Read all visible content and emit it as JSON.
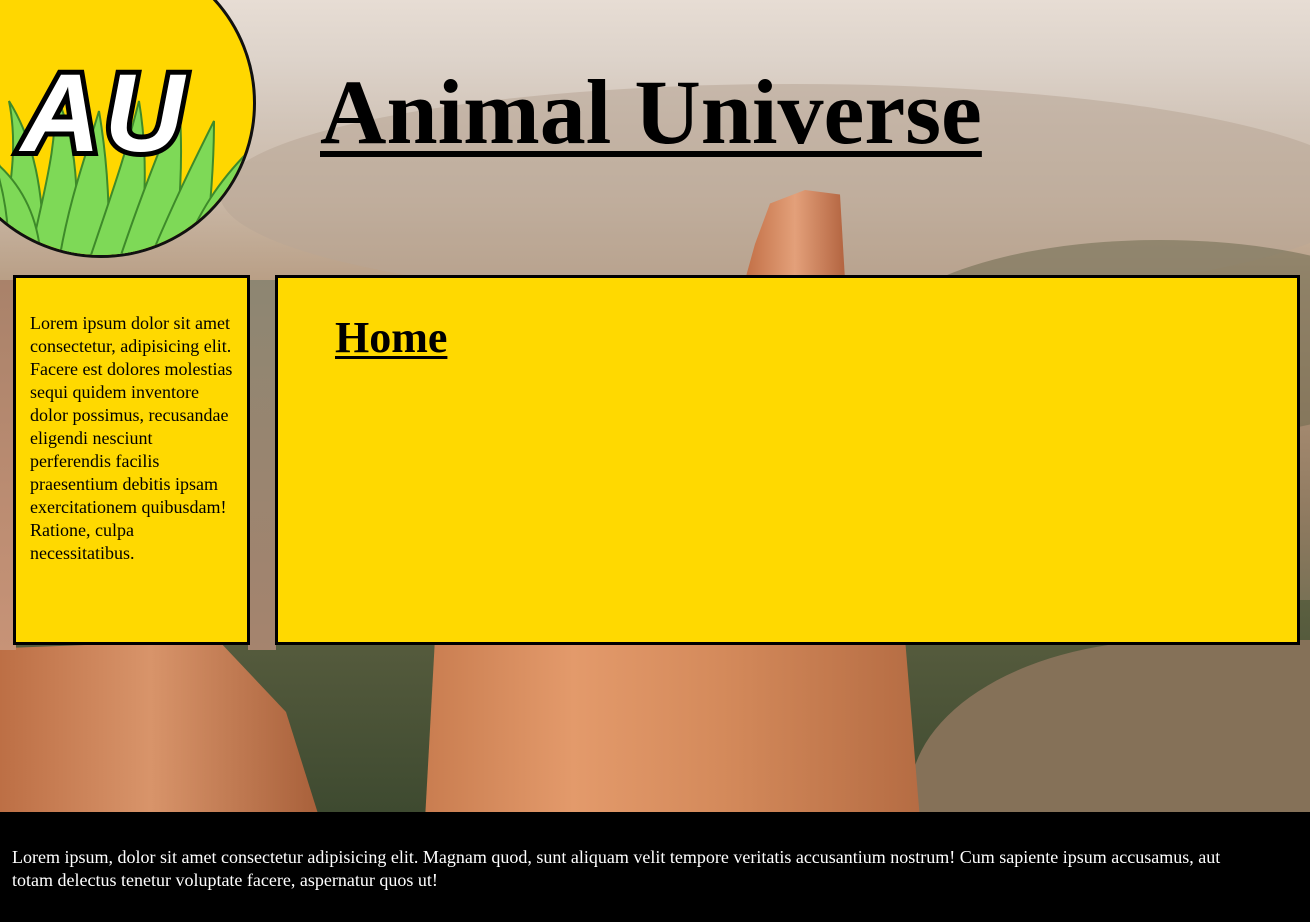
{
  "header": {
    "logo_text": "AU",
    "title": "Animal Universe"
  },
  "sidebar": {
    "text": "Lorem ipsum dolor sit amet consectetur, adipisicing elit. Facere est dolores molestias sequi quidem inventore dolor possimus, recusandae eligendi nesciunt perferendis facilis praesentium debitis ipsam exercitationem quibusdam! Ratione, culpa necessitatibus."
  },
  "main": {
    "heading": "Home"
  },
  "footer": {
    "text": "Lorem ipsum, dolor sit amet consectetur adipisicing elit. Magnam quod, sunt aliquam velit tempore veritatis accusantium nostrum! Cum sapiente ipsum accusamus, aut totam delectus tenetur voluptate facere, aspernatur quos ut!"
  },
  "colors": {
    "panel_yellow": "#ffd900",
    "logo_yellow": "#ffd700",
    "grass_green": "#7ed957",
    "footer_black": "#000000"
  },
  "icons": {
    "logo": "au-grass-logo"
  }
}
